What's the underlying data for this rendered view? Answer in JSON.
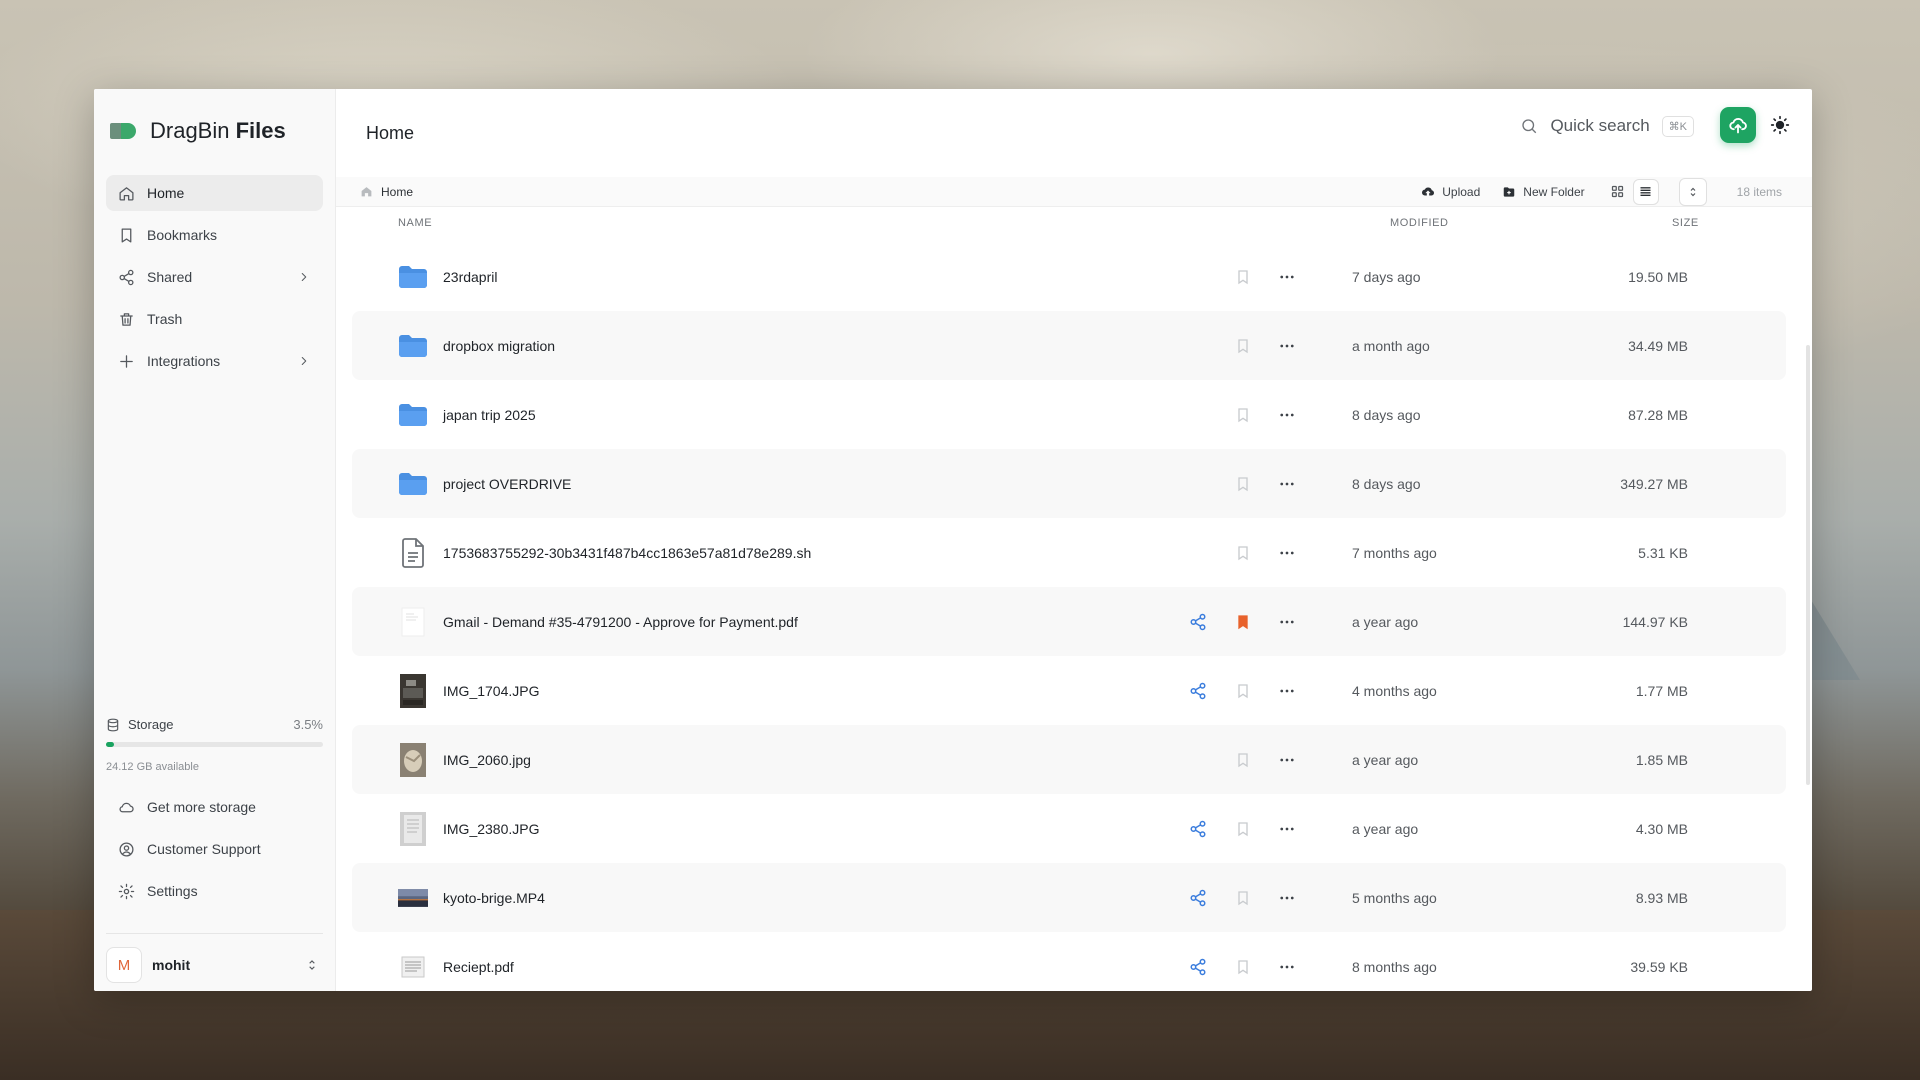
{
  "brand": {
    "name_light": "DragBin",
    "name_bold": "Files"
  },
  "sidebar": {
    "items": [
      {
        "label": "Home",
        "icon": "home-icon",
        "active": true
      },
      {
        "label": "Bookmarks",
        "icon": "bookmark-icon"
      },
      {
        "label": "Shared",
        "icon": "share-icon",
        "chevron": true
      },
      {
        "label": "Trash",
        "icon": "trash-icon"
      },
      {
        "label": "Integrations",
        "icon": "plus-icon",
        "chevron": true
      }
    ],
    "storage": {
      "label": "Storage",
      "percent_label": "3.5%",
      "percent": 3.5,
      "available": "24.12 GB available"
    },
    "bottom_items": [
      {
        "label": "Get more storage",
        "icon": "cloud-icon"
      },
      {
        "label": "Customer Support",
        "icon": "support-icon"
      },
      {
        "label": "Settings",
        "icon": "gear-icon"
      }
    ],
    "user": {
      "initial": "M",
      "name": "mohit"
    }
  },
  "header": {
    "title": "Home",
    "search_label": "Quick search",
    "shortcut": "⌘K"
  },
  "toolbar": {
    "breadcrumb": "Home",
    "upload_label": "Upload",
    "new_folder_label": "New Folder",
    "items_count": "18 items"
  },
  "columns": {
    "name": "NAME",
    "modified": "MODIFIED",
    "size": "SIZE"
  },
  "files": [
    {
      "name": "23rdapril",
      "type": "folder",
      "modified": "7 days ago",
      "size": "19.50 MB",
      "shared": false,
      "bookmarked": false
    },
    {
      "name": "dropbox migration",
      "type": "folder",
      "modified": "a month ago",
      "size": "34.49 MB",
      "shared": false,
      "bookmarked": false
    },
    {
      "name": "japan trip 2025",
      "type": "folder",
      "modified": "8 days ago",
      "size": "87.28 MB",
      "shared": false,
      "bookmarked": false
    },
    {
      "name": "project OVERDRIVE",
      "type": "folder",
      "modified": "8 days ago",
      "size": "349.27 MB",
      "shared": false,
      "bookmarked": false
    },
    {
      "name": "1753683755292-30b3431f487b4cc1863e57a81d78e289.sh",
      "type": "doc",
      "modified": "7 months ago",
      "size": "5.31 KB",
      "shared": false,
      "bookmarked": false
    },
    {
      "name": "Gmail - Demand #35-4791200 - Approve for Payment.pdf",
      "type": "pdf",
      "modified": "a year ago",
      "size": "144.97 KB",
      "shared": true,
      "bookmarked": true
    },
    {
      "name": "IMG_1704.JPG",
      "type": "img-dark",
      "modified": "4 months ago",
      "size": "1.77 MB",
      "shared": true,
      "bookmarked": false
    },
    {
      "name": "IMG_2060.jpg",
      "type": "img-rock",
      "modified": "a year ago",
      "size": "1.85 MB",
      "shared": false,
      "bookmarked": false
    },
    {
      "name": "IMG_2380.JPG",
      "type": "img-paper",
      "modified": "a year ago",
      "size": "4.30 MB",
      "shared": true,
      "bookmarked": false
    },
    {
      "name": "kyoto-brige.MP4",
      "type": "video",
      "modified": "5 months ago",
      "size": "8.93 MB",
      "shared": true,
      "bookmarked": false
    },
    {
      "name": "Reciept.pdf",
      "type": "receipt",
      "modified": "8 months ago",
      "size": "39.59 KB",
      "shared": true,
      "bookmarked": false
    }
  ],
  "colors": {
    "accent": "#1ea462",
    "folder": "#4a90e2",
    "share": "#3b7ddd",
    "bookmark_on": "#e8622c"
  }
}
